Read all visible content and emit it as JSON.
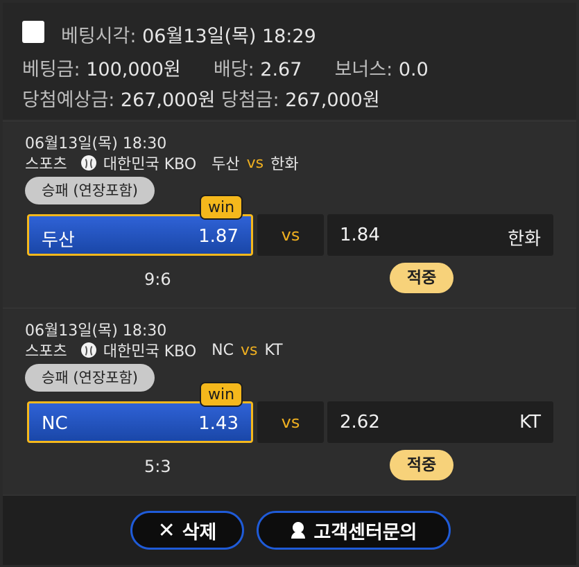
{
  "summary": {
    "bet_time_label": "베팅시각:",
    "bet_time_value": "06월13일(목) 18:29",
    "stake_label": "베팅금:",
    "stake_value": "100,000원",
    "odds_label": "배당:",
    "odds_value": "2.67",
    "bonus_label": "보너스:",
    "bonus_value": "0.0",
    "expected_label": "당첨예상금:",
    "expected_value": "267,000원",
    "won_label": "당첨금:",
    "won_value": "267,000원"
  },
  "matches": [
    {
      "datetime": "06월13일(목) 18:30",
      "sport": "스포츠",
      "sport_icon": "baseball-icon",
      "league": "대한민국 KBO",
      "home_team": "두산",
      "vs_text": "vs",
      "away_team": "한화",
      "market": "승패 (연장포함)",
      "win_badge": "win",
      "home_odds": "1.87",
      "away_odds": "1.84",
      "score": "9:6",
      "result": "적중"
    },
    {
      "datetime": "06월13일(목) 18:30",
      "sport": "스포츠",
      "sport_icon": "baseball-icon",
      "league": "대한민국 KBO",
      "home_team": "NC",
      "vs_text": "vs",
      "away_team": "KT",
      "market": "승패 (연장포함)",
      "win_badge": "win",
      "home_odds": "1.43",
      "away_odds": "2.62",
      "score": "5:3",
      "result": "적중"
    }
  ],
  "footer": {
    "delete_label": "삭제",
    "delete_icon": "close-icon",
    "support_label": "고객센터문의",
    "support_icon": "headset-icon"
  },
  "colors": {
    "accent": "#f5b81c",
    "selected_blue": "#1f5bd8",
    "result_badge": "#f7d27a"
  }
}
